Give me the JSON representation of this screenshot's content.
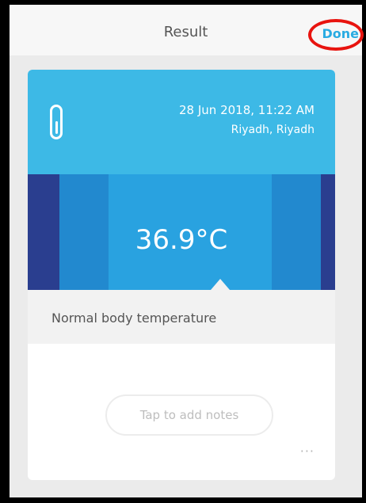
{
  "header": {
    "title": "Result",
    "done_label": "Done"
  },
  "reading": {
    "datetime": "28 Jun 2018, 11:22 AM",
    "location": "Riyadh, Riyadh",
    "temperature": "36.9°C",
    "status": "Normal body temperature"
  },
  "notes": {
    "placeholder": "Tap to add notes"
  },
  "more_label": "···",
  "colors": {
    "accent": "#3db9e6",
    "done": "#29abe2",
    "highlight_ring": "#e8140f"
  },
  "icons": {
    "thermometer": "thermometer-icon",
    "more": "more-options-icon"
  }
}
